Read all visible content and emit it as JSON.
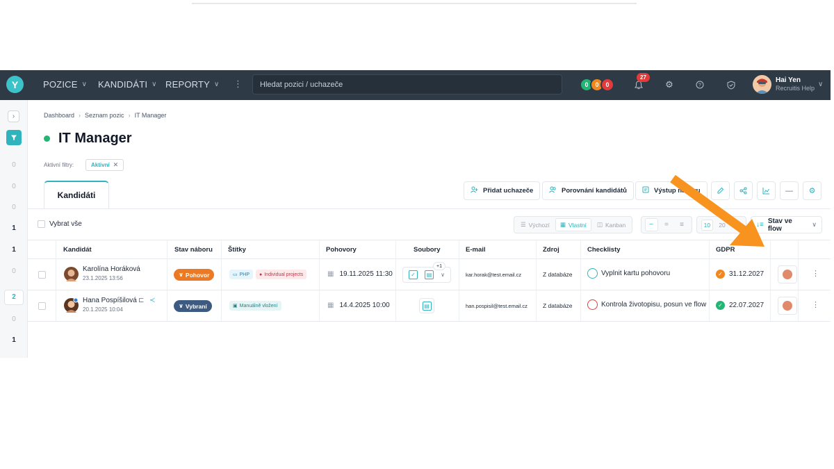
{
  "nav": {
    "items": [
      {
        "label": "POZICE"
      },
      {
        "label": "KANDIDÁTI"
      },
      {
        "label": "REPORTY"
      }
    ],
    "search_placeholder": "Hledat pozici / uchazeče",
    "counters": [
      {
        "value": "0",
        "color": "#22b573"
      },
      {
        "value": "0",
        "color": "#f2871f"
      },
      {
        "value": "0",
        "color": "#e23b3b"
      }
    ],
    "notifications": "27",
    "user": {
      "name": "Hai Yen",
      "role": "Recruitis Help"
    }
  },
  "rail": {
    "numbers": [
      "0",
      "0",
      "0",
      "1",
      "1",
      "0",
      "2",
      "0",
      "1"
    ]
  },
  "breadcrumb": [
    "Dashboard",
    "Seznam pozic",
    "IT Manager"
  ],
  "page_title": "IT Manager",
  "filters": {
    "label": "Aktivní filtry:",
    "chip": "Aktivní"
  },
  "tab": "Kandidáti",
  "actions": {
    "add": "Přidat uchazeče",
    "compare": "Porovnání kandidátů",
    "output": "Výstup náboru"
  },
  "toolbar": {
    "select_all": "Vybrat vše",
    "views": [
      "Výchozí",
      "Vlastní",
      "Kanban"
    ],
    "page_sizes": [
      "10",
      "20",
      "50"
    ],
    "sort": "Stav ve flow"
  },
  "table": {
    "headers": [
      "Kandidát",
      "Stav náboru",
      "Štítky",
      "Pohovory",
      "Soubory",
      "E-mail",
      "Zdroj",
      "Checklisty",
      "GDPR"
    ],
    "rows": [
      {
        "name": "Karolína Horáková",
        "date": "23.1.2025 13:56",
        "status": "Pohovor",
        "status_color": "#ec7a25",
        "tags": [
          "PHP",
          "Individual projects"
        ],
        "interview": "19.11.2025 11:30",
        "files_extra": "+1",
        "email": "kar.horak@test.email.cz",
        "source": "Z databáze",
        "checklist": "Vyplnit kartu pohovoru",
        "gdpr": "31.12.2027",
        "gdpr_color": "#f2871f"
      },
      {
        "name": "Hana Pospíšilová",
        "date": "20.1.2025 10:04",
        "status": "Vybraní",
        "status_color": "#3d5a80",
        "tags": [
          "Manuálně vložení"
        ],
        "interview": "14.4.2025 10:00",
        "email": "han.pospisil@test.email.cz",
        "source": "Z databáze",
        "checklist": "Kontrola životopisu, posun ve flow",
        "gdpr": "22.07.2027",
        "gdpr_color": "#22b573"
      }
    ]
  },
  "colors": {
    "accent": "#2fb3bd",
    "navbar": "#2f3a47",
    "arrow": "#f7931e"
  }
}
